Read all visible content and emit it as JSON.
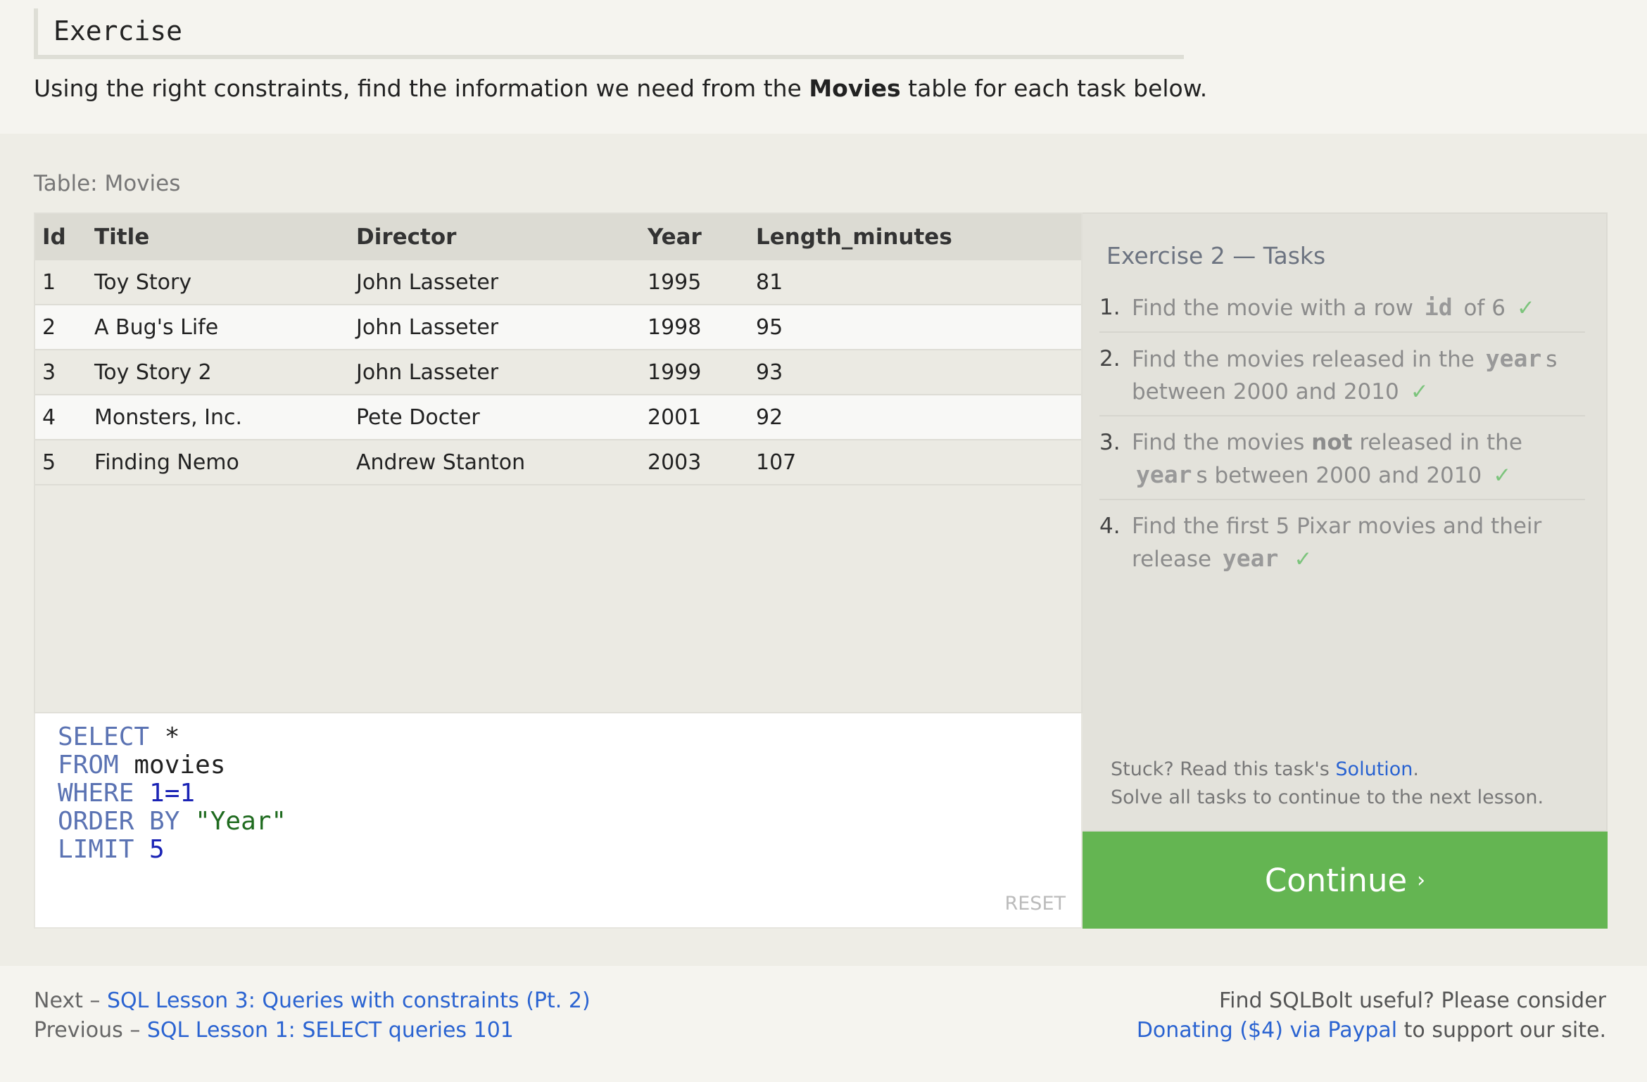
{
  "header": {
    "title": "Exercise"
  },
  "intro": {
    "before": "Using the right constraints, find the information we need from the ",
    "bold": "Movies",
    "after": " table for each task below."
  },
  "table": {
    "caption": "Table: Movies",
    "columns": [
      "Id",
      "Title",
      "Director",
      "Year",
      "Length_minutes"
    ],
    "rows": [
      [
        "1",
        "Toy Story",
        "John Lasseter",
        "1995",
        "81"
      ],
      [
        "2",
        "A Bug's Life",
        "John Lasseter",
        "1998",
        "95"
      ],
      [
        "3",
        "Toy Story 2",
        "John Lasseter",
        "1999",
        "93"
      ],
      [
        "4",
        "Monsters, Inc.",
        "Pete Docter",
        "2001",
        "92"
      ],
      [
        "5",
        "Finding Nemo",
        "Andrew Stanton",
        "2003",
        "107"
      ]
    ]
  },
  "editor": {
    "lines": [
      {
        "kw": "SELECT",
        "rest": " *"
      },
      {
        "kw": "FROM",
        "rest": " movies"
      },
      {
        "kw": "WHERE",
        "num": " 1=1"
      },
      {
        "kw": "ORDER BY",
        "str": " \"Year\""
      },
      {
        "kw": "LIMIT",
        "num": " 5"
      }
    ],
    "reset_label": "RESET"
  },
  "tasks": {
    "title": "Exercise 2 — Tasks",
    "items": [
      {
        "num": "1.",
        "parts": [
          {
            "t": "Find the movie with a row "
          },
          {
            "c": "id"
          },
          {
            "t": " of 6"
          }
        ],
        "check": "✓"
      },
      {
        "num": "2.",
        "parts": [
          {
            "t": "Find the movies released in the "
          },
          {
            "c": "year"
          },
          {
            "t": "s between 2000 and 2010"
          }
        ],
        "check": "✓"
      },
      {
        "num": "3.",
        "parts": [
          {
            "t": "Find the movies "
          },
          {
            "b": "not"
          },
          {
            "t": " released in the "
          },
          {
            "c": "year"
          },
          {
            "t": "s between 2000 and 2010"
          }
        ],
        "check": "✓"
      },
      {
        "num": "4.",
        "parts": [
          {
            "t": "Find the first 5 Pixar movies and their release "
          },
          {
            "c": "year"
          }
        ],
        "check": "✓"
      }
    ],
    "stuck_before": "Stuck? Read this task's ",
    "solution_link": "Solution",
    "stuck_after": ".",
    "solve_all": "Solve all tasks to continue to the next lesson."
  },
  "continue_button": {
    "label": "Continue",
    "chevron": "›"
  },
  "footer": {
    "next_label": "Next",
    "next_link": "SQL Lesson 3: Queries with constraints (Pt. 2)",
    "prev_label": "Previous",
    "prev_link": "SQL Lesson 1: SELECT queries 101",
    "dash": " – ",
    "support_line1": "Find SQLBolt useful? Please consider",
    "donate_link": "Donating ($4) via Paypal",
    "support_tail": " to support our site."
  },
  "colors": {
    "accent_green": "#64b552",
    "link_blue": "#2a63d1",
    "keyword": "#5b73b3"
  }
}
